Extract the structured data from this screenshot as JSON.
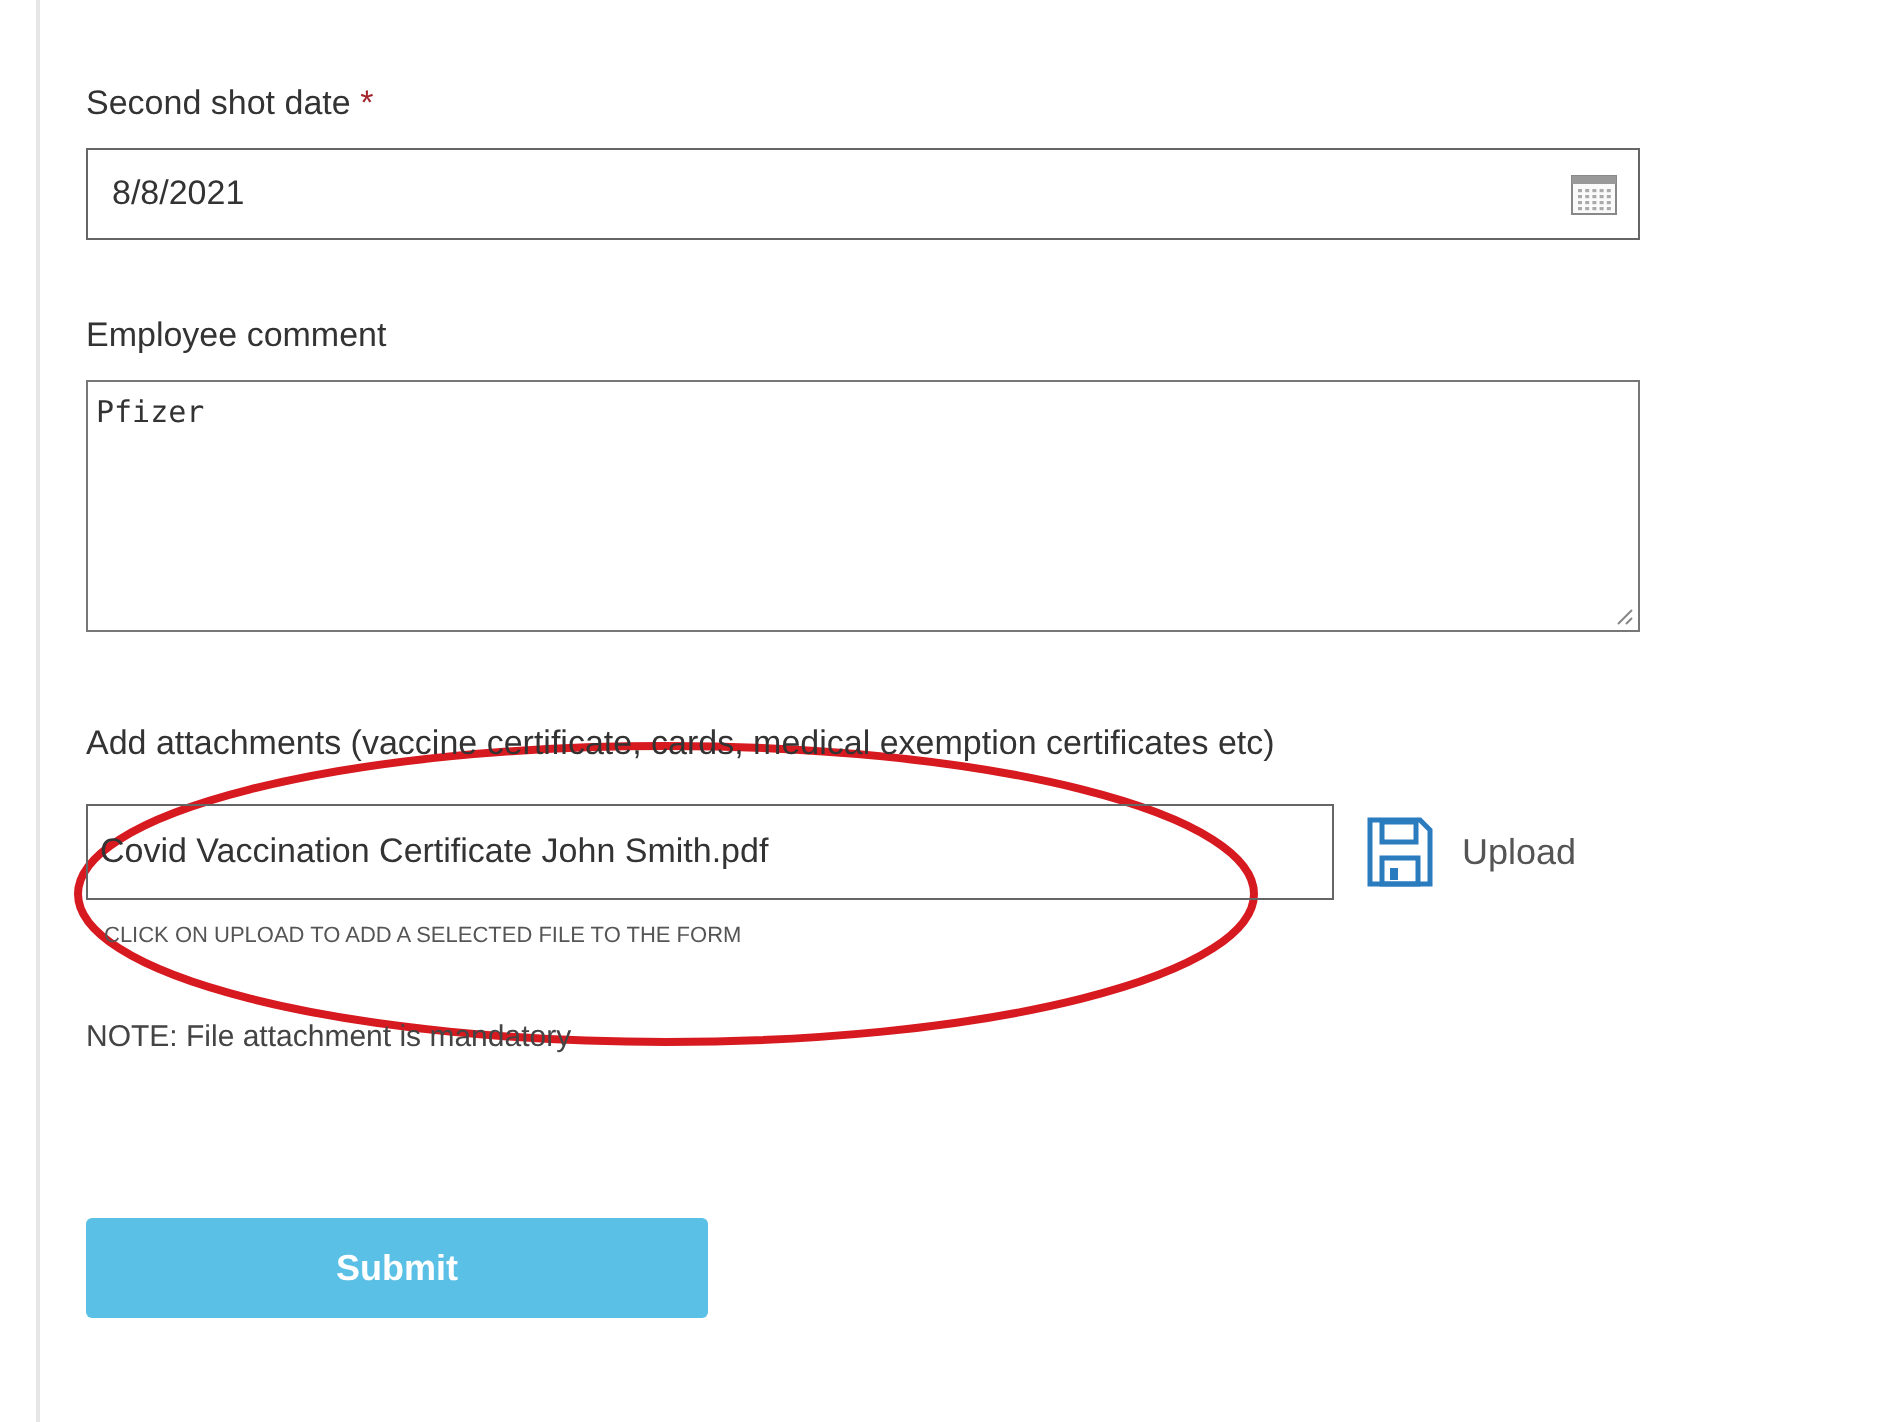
{
  "fields": [
    {
      "kind": "date",
      "label": "Second shot date",
      "required_mark": "*",
      "value": "8/8/2021"
    },
    {
      "kind": "textarea",
      "label": "Employee comment",
      "value": "Pfizer"
    }
  ],
  "attachments": {
    "label": "Add attachments (vaccine certificate, cards, medical exemption certificates etc)",
    "file_name": "Covid Vaccination Certificate John Smith.pdf",
    "upload_label": "Upload",
    "hint": "CLICK ON UPLOAD TO ADD A SELECTED FILE TO THE FORM"
  },
  "note": "NOTE: File attachment is mandatory",
  "submit": {
    "label": "Submit"
  }
}
